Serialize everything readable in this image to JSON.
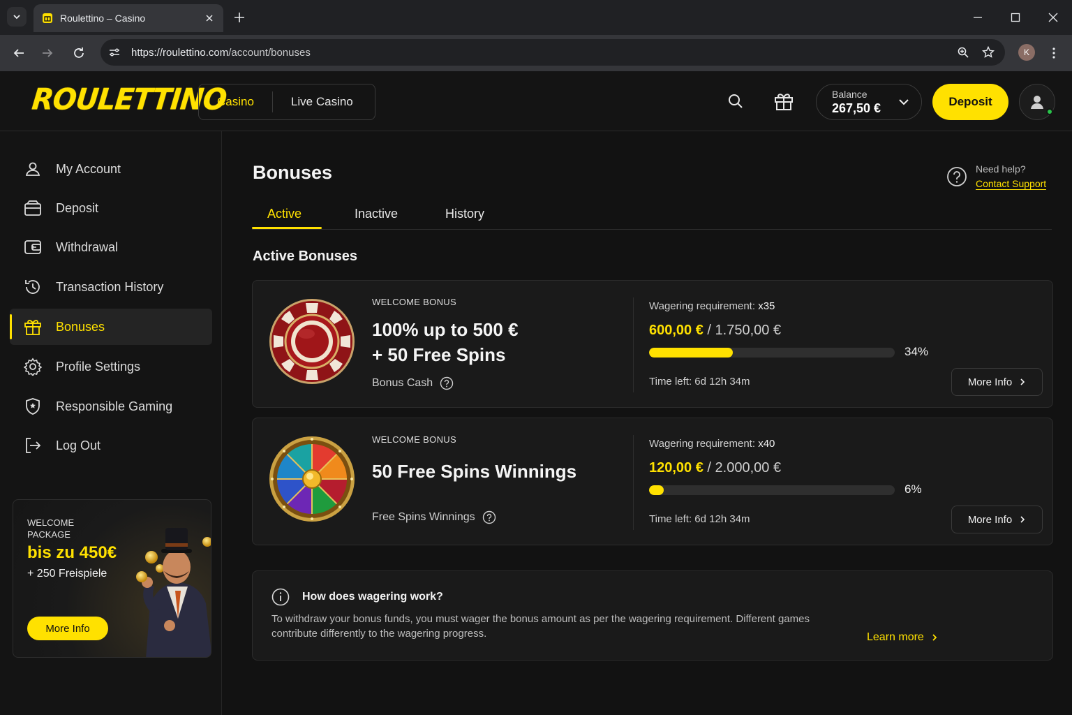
{
  "browser": {
    "tab_title": "Roulettino – Casino",
    "url_host": "https://roulettino.com",
    "url_path": "/account/bonuses",
    "profile_initial": "K"
  },
  "header": {
    "logo": "ROULETTINO",
    "nav": [
      "Casino",
      "Live Casino"
    ],
    "balance_label": "Balance",
    "balance_value": "267,50 €",
    "deposit_label": "Deposit",
    "accent_color": "#ffe100"
  },
  "sidebar": {
    "items": [
      {
        "label": "My Account",
        "icon": "user-icon"
      },
      {
        "label": "Deposit",
        "icon": "wallet-icon"
      },
      {
        "label": "Withdrawal",
        "icon": "withdraw-icon"
      },
      {
        "label": "Transaction History",
        "icon": "history-icon"
      },
      {
        "label": "Bonuses",
        "icon": "gift-icon",
        "active": true
      },
      {
        "label": "Profile Settings",
        "icon": "gear-icon"
      },
      {
        "label": "Responsible Gaming",
        "icon": "shield-icon"
      },
      {
        "label": "Log Out",
        "icon": "logout-icon"
      }
    ],
    "promo": {
      "eyebrow": "WELCOME PACKAGE",
      "headline": "bis zu 450€",
      "sub": "+ 250 Freispiele",
      "button": "More Info"
    }
  },
  "main": {
    "title": "Bonuses",
    "help_question": "Need help?",
    "help_link": "Contact Support",
    "tabs": [
      "Active",
      "Inactive",
      "History"
    ],
    "active_tab": "Active",
    "section_title": "Active Bonuses",
    "bonuses": [
      {
        "eyebrow": "WELCOME BONUS",
        "title_line1": "100% up to 500 €",
        "title_line2": "+ 50 Free Spins",
        "type": "Bonus Cash",
        "wagering_label": "Wagering requirement:",
        "wagering_value": "x35",
        "current": "600,00 €",
        "target": "/ 1.750,00 €",
        "progress": 0.34,
        "progress_label": "34%",
        "time_left": "Time left:  6d 12h 34m",
        "more": "More Info",
        "art": "casino-chip"
      },
      {
        "eyebrow": "WELCOME BONUS",
        "title_line1": "50 Free Spins Winnings",
        "title_line2": "",
        "type": "Free Spins Winnings",
        "wagering_label": "Wagering requirement:",
        "wagering_value": "x40",
        "current": "120,00 €",
        "target": "/ 2.000,00 €",
        "progress": 0.06,
        "progress_label": "6%",
        "time_left": "Time left:  6d 12h 34m",
        "more": "More Info",
        "art": "prize-wheel"
      }
    ],
    "info": {
      "title": "How does wagering work?",
      "text": "To withdraw your bonus funds, you must wager the bonus amount as per the wagering requirement. Different games contribute differently to the wagering progress.",
      "link": "Learn more"
    }
  }
}
